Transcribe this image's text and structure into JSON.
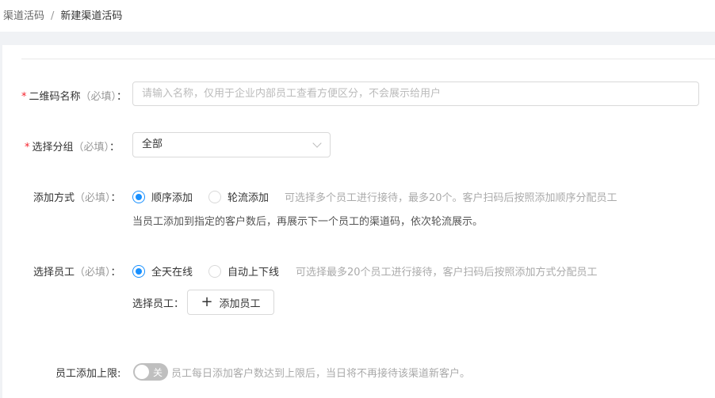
{
  "breadcrumb": {
    "parent": "渠道活码",
    "separator": "/",
    "current": "新建渠道活码"
  },
  "form": {
    "name": {
      "label": "二维码名称",
      "optional": "（必填）",
      "colon": "：",
      "placeholder": "请输入名称，仅用于企业内部员工查看方便区分，不会展示给用户"
    },
    "group": {
      "label": "选择分组",
      "optional": "（必填）",
      "colon": "：",
      "value": "全部"
    },
    "add_mode": {
      "label": "添加方式",
      "optional": "（必填）",
      "colon": "：",
      "options": [
        "顺序添加",
        "轮流添加"
      ],
      "selected": "顺序添加",
      "hint": "可选择多个员工进行接待，最多20个。客户扫码后按照添加顺序分配员工",
      "note": "当员工添加到指定的客户数后，再展示下一个员工的渠道码，依次轮流展示。"
    },
    "staff": {
      "label": "选择员工",
      "optional": "（必填）",
      "colon": "：",
      "options": [
        "全天在线",
        "自动上下线"
      ],
      "selected": "全天在线",
      "hint": "可选择最多20个员工进行接待，客户扫码后按照添加方式分配员工",
      "select_label": "选择员工：",
      "add_button": "添加员工"
    },
    "limit": {
      "label": "员工添加上限:",
      "switch_text": "关",
      "switch_on": false,
      "hint": "员工每日添加客户数达到上限后，当日将不再接待该渠道新客户。"
    }
  },
  "colors": {
    "primary": "#1890ff",
    "required": "#f5222d"
  }
}
